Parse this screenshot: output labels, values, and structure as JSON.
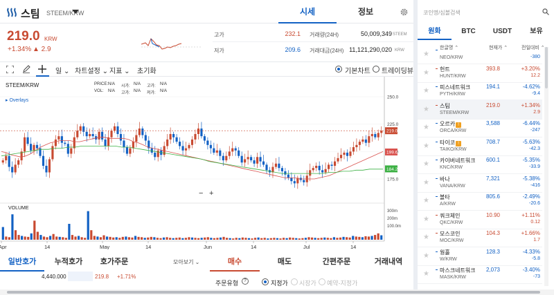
{
  "header": {
    "coin_name": "스팀",
    "coin_pair": "STEEM/KRW",
    "tabs": [
      {
        "label": "시세"
      },
      {
        "label": "정보"
      }
    ]
  },
  "summary": {
    "price": "219.0",
    "unit": "KRW",
    "change_pct": "+1.34%",
    "change_abs": "▲ 2.9",
    "high_label": "고가",
    "high_value": "232.1",
    "low_label": "저가",
    "low_value": "209.6",
    "volume_label": "거래량(24H)",
    "volume_value": "50,009,349",
    "volume_unit": "STEEM",
    "amount_label": "거래대금(24H)",
    "amount_value": "11,121,290,020",
    "amount_unit": "KRW"
  },
  "toolbar": {
    "period": "일",
    "chart_settings": "차트설정",
    "indicators": "지표",
    "reset": "초기화",
    "basic_chart": "기본차트",
    "tradingview": "트레이딩뷰"
  },
  "chart": {
    "symbol": "STEEM/KRW",
    "ohlc_labels": {
      "price": "PRICE:",
      "vol": "VOL:",
      "open": "시가:",
      "high": "고가:",
      "low": "저가:",
      "close": "종가:",
      "na": "N/A"
    },
    "overlays": "▸ Overlays",
    "volume_label": "VOLUME",
    "zoom_out": "−",
    "zoom_in": "+",
    "colors": {
      "up": "#c84a31",
      "down": "#1261c4",
      "ma_short": "#d9534f",
      "ma_long": "#3cb043"
    }
  },
  "chart_data": {
    "type": "candlestick",
    "x_ticks": [
      "Apr",
      "14",
      "May",
      "14",
      "Jun",
      "14",
      "Jul",
      "14"
    ],
    "y_ticks": [
      "250.0",
      "225.0",
      "200.0",
      "175.0"
    ],
    "ylim": [
      158,
      262
    ],
    "price_markers": [
      {
        "label": "219.0",
        "value": 219.0,
        "color": "#c84a31"
      },
      {
        "label": "199.6",
        "value": 199.6,
        "color": "#d9534f"
      },
      {
        "label": "184.2",
        "value": 184.2,
        "color": "#3cb043"
      }
    ],
    "volume_ticks": [
      "300m",
      "200m",
      "100.0m"
    ],
    "closes": [
      192,
      196,
      186,
      181,
      188,
      192,
      200,
      213,
      207,
      201,
      206,
      203,
      196,
      187,
      181,
      193,
      205,
      211,
      214,
      208,
      207,
      198,
      203,
      213,
      219,
      223,
      218,
      214,
      216,
      214,
      211,
      218,
      211,
      205,
      213,
      219,
      223,
      216,
      210,
      204,
      198,
      203,
      209,
      215,
      221,
      215,
      210,
      203,
      199,
      195,
      201,
      197,
      205,
      211,
      216,
      213,
      209,
      205,
      201,
      203,
      206,
      211,
      216,
      221,
      214,
      210,
      206,
      203,
      199,
      201,
      196,
      192,
      196,
      200,
      203,
      201,
      196,
      190,
      193,
      195,
      192,
      189,
      195,
      191,
      188,
      183,
      181,
      186,
      189,
      185,
      182,
      179,
      176,
      173,
      171,
      176,
      174,
      172,
      178,
      183,
      185,
      187,
      183,
      181,
      184,
      188,
      187,
      191,
      194,
      197,
      199,
      196,
      200,
      204,
      206,
      209,
      211,
      208,
      214,
      216,
      213,
      217,
      219
    ],
    "ma_short": [
      200,
      199,
      197,
      196,
      195,
      196,
      198,
      201,
      204,
      206,
      208,
      209,
      210,
      210,
      210,
      209,
      209,
      210,
      211,
      212,
      213,
      213,
      212,
      212,
      212,
      212,
      211,
      209,
      208,
      206,
      204,
      203,
      202,
      201,
      200,
      199,
      198,
      197,
      196,
      195,
      194,
      193,
      192,
      191,
      190,
      189,
      188,
      187,
      186,
      185,
      184,
      183,
      182,
      181,
      180,
      179,
      178,
      177,
      176,
      176,
      176,
      175,
      175,
      175,
      175,
      176,
      177,
      178,
      180,
      182,
      184,
      186,
      188,
      190,
      192,
      194,
      196,
      198,
      200
    ],
    "ma_long": [
      196,
      197,
      198,
      199,
      200,
      201,
      202,
      202,
      203,
      203,
      204,
      204,
      205,
      205,
      205,
      205,
      205,
      205,
      204,
      204,
      203,
      202,
      201,
      200,
      199,
      198,
      197,
      196,
      195,
      194,
      193,
      191,
      190,
      189,
      188,
      187,
      186,
      185,
      184,
      183,
      182,
      181,
      180,
      180,
      180,
      180,
      180,
      180,
      180,
      181,
      181,
      182,
      182,
      183,
      183,
      184,
      184,
      184
    ],
    "volumes": [
      40,
      10,
      8,
      80,
      30,
      15,
      12,
      10,
      9,
      20,
      60,
      25,
      15,
      10,
      8,
      12,
      18,
      10,
      9,
      8,
      6,
      50,
      15,
      10,
      12,
      8,
      6,
      90,
      30,
      12,
      10,
      8,
      14,
      10,
      9,
      7,
      8,
      6,
      9,
      10,
      8,
      7,
      12,
      9,
      8,
      6,
      7,
      9,
      8,
      6,
      5,
      7,
      8,
      6,
      5,
      6,
      7,
      5,
      6,
      8,
      7,
      6,
      5,
      6,
      7,
      8,
      6,
      5,
      6,
      7,
      9,
      6,
      5,
      4,
      6,
      5,
      7,
      6,
      5,
      4,
      6,
      7,
      5,
      6,
      4,
      5,
      6,
      5,
      4,
      6,
      5,
      7,
      6,
      5,
      4,
      5,
      6,
      8,
      7,
      6,
      5,
      6,
      7,
      6,
      5,
      8,
      6,
      7,
      9,
      8,
      7,
      12,
      10,
      9,
      8,
      11,
      10,
      12,
      15,
      20,
      14
    ]
  },
  "bottom": {
    "tabs": [
      {
        "label": "일반호가"
      },
      {
        "label": "누적호가"
      },
      {
        "label": "호가주문"
      }
    ],
    "view_more": "모아보기 ⌄",
    "order_row": {
      "qty": "4,440.000",
      "price": "219.8",
      "pct": "+1.71%"
    },
    "trade_tabs": [
      {
        "label": "매수"
      },
      {
        "label": "매도"
      },
      {
        "label": "간편주문"
      },
      {
        "label": "거래내역"
      }
    ],
    "order_type_label": "주문유형",
    "order_types": [
      "지정가",
      "시장가",
      "예약-지정가"
    ]
  },
  "market": {
    "search_placeholder": "코인명/심볼검색",
    "tabs": [
      {
        "label": "원화"
      },
      {
        "label": "BTC"
      },
      {
        "label": "USDT"
      },
      {
        "label": "보유"
      }
    ],
    "col_name": "한글명 ⌃",
    "col_price": "현재가 ⌃",
    "col_change": "전일대비 ⌃",
    "rows": [
      {
        "name": "",
        "pair": "NEO/KRW",
        "price": "",
        "pct": "",
        "abs": "-380",
        "dir": "down"
      },
      {
        "name": "헌트",
        "pair": "HUNT/KRW",
        "price": "393.8",
        "pct": "+3.20%",
        "abs": "12.2",
        "dir": "up"
      },
      {
        "name": "피스네트워크",
        "pair": "PYTH/KRW",
        "price": "194.1",
        "pct": "-4.62%",
        "abs": "-9.4",
        "dir": "down"
      },
      {
        "name": "스팀",
        "pair": "STEEM/KRW",
        "price": "219.0",
        "pct": "+1.34%",
        "abs": "2.9",
        "dir": "up",
        "selected": true
      },
      {
        "name": "오르카",
        "pair": "ORCA/KRW",
        "price": "3,588",
        "pct": "-6.44%",
        "abs": "-247",
        "dir": "down",
        "badge": true
      },
      {
        "name": "타이코",
        "pair": "TAIKO/KRW",
        "price": "708.7",
        "pct": "-5.63%",
        "abs": "-42.3",
        "dir": "down",
        "badge": true
      },
      {
        "name": "카이버네트워크",
        "pair": "KNC/KRW",
        "price": "600.1",
        "pct": "-5.35%",
        "abs": "-33.9",
        "dir": "down"
      },
      {
        "name": "바나",
        "pair": "VANA/KRW",
        "price": "7,321",
        "pct": "-5.38%",
        "abs": "-416",
        "dir": "down"
      },
      {
        "name": "볼타",
        "pair": "A/KRW",
        "price": "805.6",
        "pct": "-2.49%",
        "abs": "-20.6",
        "dir": "down"
      },
      {
        "name": "쿼크체인",
        "pair": "QKC/KRW",
        "price": "10.90",
        "pct": "+1.11%",
        "abs": "0.12",
        "dir": "up"
      },
      {
        "name": "모스코인",
        "pair": "MOC/KRW",
        "price": "104.3",
        "pct": "+1.66%",
        "abs": "1.7",
        "dir": "up"
      },
      {
        "name": "웜홀",
        "pair": "W/KRW",
        "price": "128.3",
        "pct": "-4.33%",
        "abs": "-5.8",
        "dir": "down"
      },
      {
        "name": "마스크네트워크",
        "pair": "MASK/KRW",
        "price": "2,073",
        "pct": "-3.40%",
        "abs": "-73",
        "dir": "down"
      }
    ]
  }
}
